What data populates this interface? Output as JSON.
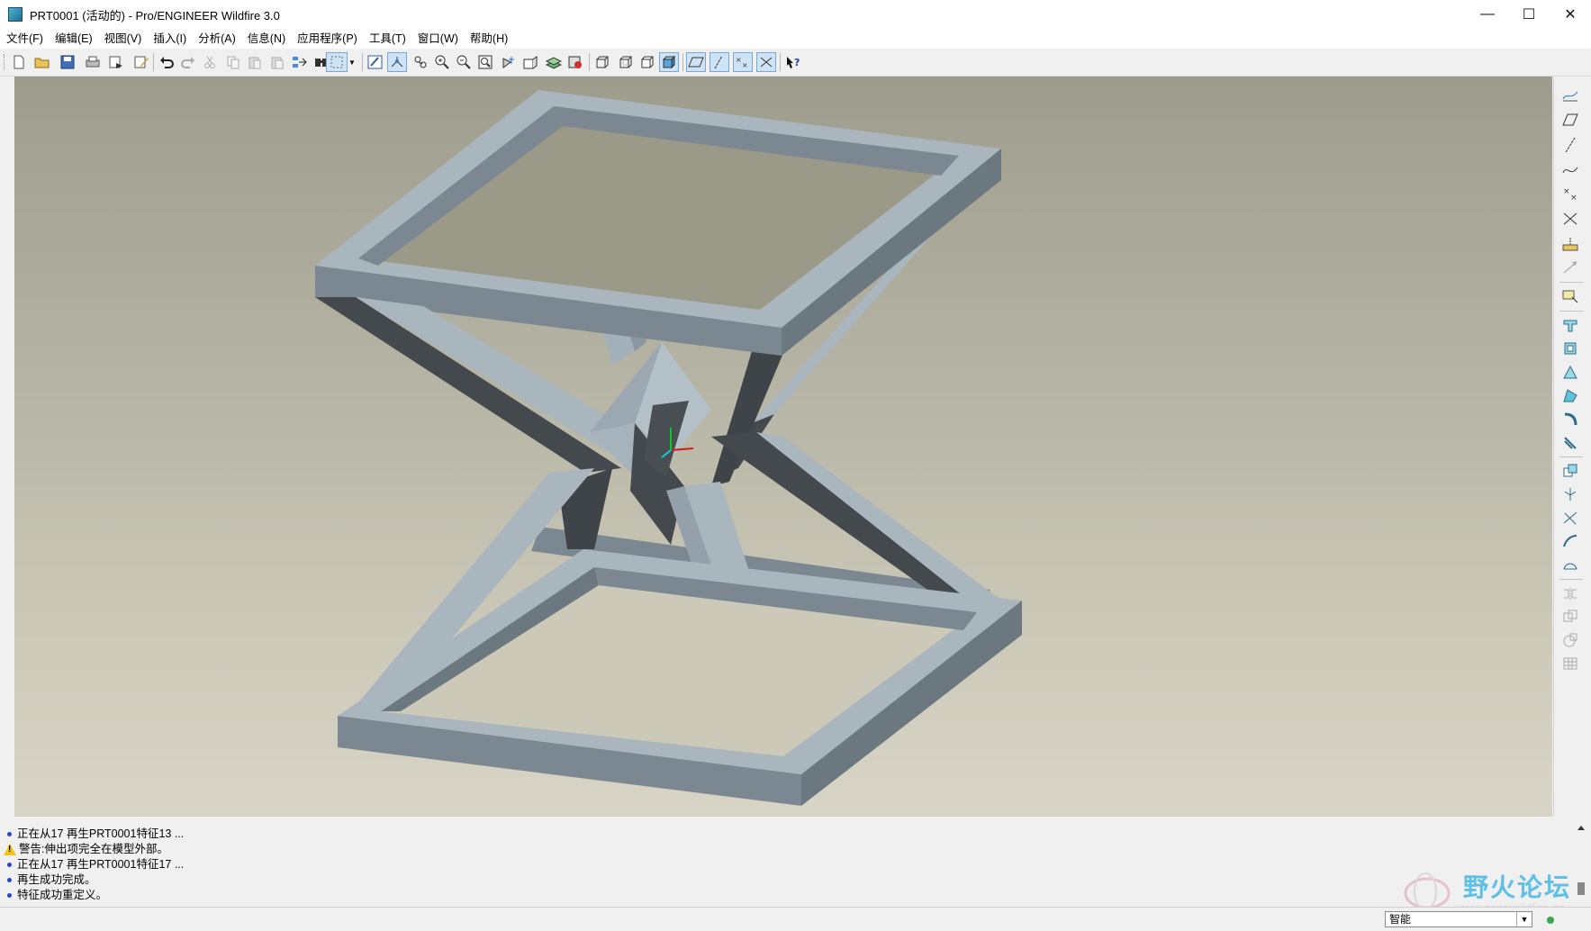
{
  "window": {
    "title": "PRT0001 (活动的) - Pro/ENGINEER Wildfire 3.0",
    "min_glyph": "—",
    "max_glyph": "☐",
    "close_glyph": "✕"
  },
  "menu": [
    "文件(F)",
    "编辑(E)",
    "视图(V)",
    "插入(I)",
    "分析(A)",
    "信息(N)",
    "应用程序(P)",
    "工具(T)",
    "窗口(W)",
    "帮助(H)"
  ],
  "toolbar": {
    "buttons": [
      "new-icon",
      "open-icon",
      "save-icon",
      "print-icon",
      "send-icon",
      "edit-icon",
      "undo-icon",
      "redo-icon",
      "cut-icon",
      "copy-icon",
      "paste-icon",
      "paste-special-icon",
      "regenerate-icon",
      "find-icon",
      "selection-filter-icon",
      "repaint-icon",
      "spin-center-icon",
      "orient-icon",
      "zoom-in-icon",
      "zoom-out-icon",
      "refit-icon",
      "reorient-icon",
      "view-manager-icon",
      "layers-icon",
      "appearance-icon",
      "wireframe-icon",
      "hidden-line-icon",
      "no-hidden-icon",
      "shading-icon",
      "datum-planes-icon",
      "datum-axes-icon",
      "datum-points-icon",
      "coord-sys-icon",
      "context-help-icon"
    ]
  },
  "right_toolbar": {
    "buttons": [
      "sketch-tool-icon",
      "datum-plane-icon",
      "datum-axis-icon",
      "datum-curve-icon",
      "datum-point-icon",
      "coord-system-icon",
      "analysis-icon",
      "annotation-icon",
      "extrude-icon",
      "revolve-icon",
      "variable-section-sweep-icon",
      "boundary-blend-icon",
      "hole-icon",
      "shell-icon",
      "rib-icon",
      "draft-icon",
      "round-icon",
      "chamfer-icon",
      "mirror-icon",
      "merge-icon",
      "trim-icon",
      "offset-icon",
      "thicken-icon",
      "solidify-icon"
    ]
  },
  "messages": [
    {
      "type": "info",
      "text": "正在从17 再生PRT0001特征13 ..."
    },
    {
      "type": "warning",
      "text": "警告:伸出项完全在模型外部。"
    },
    {
      "type": "info",
      "text": "正在从17 再生PRT0001特征17 ..."
    },
    {
      "type": "info",
      "text": "再生成功完成。"
    },
    {
      "type": "info",
      "text": "特征成功重定义。"
    }
  ],
  "status": {
    "filter_value": "智能"
  },
  "watermark": {
    "text": "野火论坛",
    "url": "www.proewildfire.cn"
  },
  "colors": {
    "model_light": "#a7b3bc",
    "model_mid": "#7c8891",
    "model_dark": "#44494d",
    "bg_top": "#9e9c8d",
    "bg_bottom": "#d8d5c6"
  }
}
